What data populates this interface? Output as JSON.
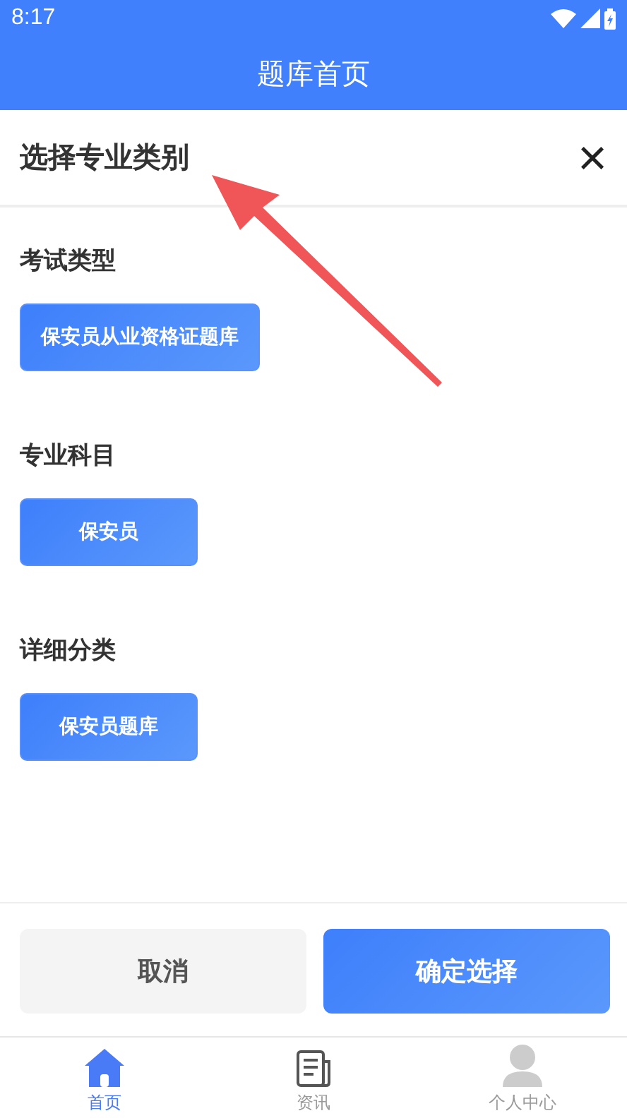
{
  "status_bar": {
    "time": "8:17"
  },
  "header": {
    "title": "题库首页"
  },
  "sheet": {
    "title": "选择专业类别",
    "close": "×"
  },
  "sections": [
    {
      "label": "考试类型",
      "options": [
        {
          "label": "保安员从业资格证题库",
          "selected": true
        }
      ]
    },
    {
      "label": "专业科目",
      "options": [
        {
          "label": "保安员",
          "selected": true
        }
      ]
    },
    {
      "label": "详细分类",
      "options": [
        {
          "label": "保安员题库",
          "selected": true
        }
      ]
    }
  ],
  "buttons": [
    {
      "label": "取消",
      "kind": "secondary"
    },
    {
      "label": "确定选择",
      "kind": "primary"
    }
  ],
  "tab_bar": [
    {
      "label": "首页",
      "kind": "home",
      "selected": true
    },
    {
      "label": "资讯",
      "kind": "news",
      "selected": false
    },
    {
      "label": "个人中心",
      "kind": "profile",
      "selected": false
    }
  ]
}
